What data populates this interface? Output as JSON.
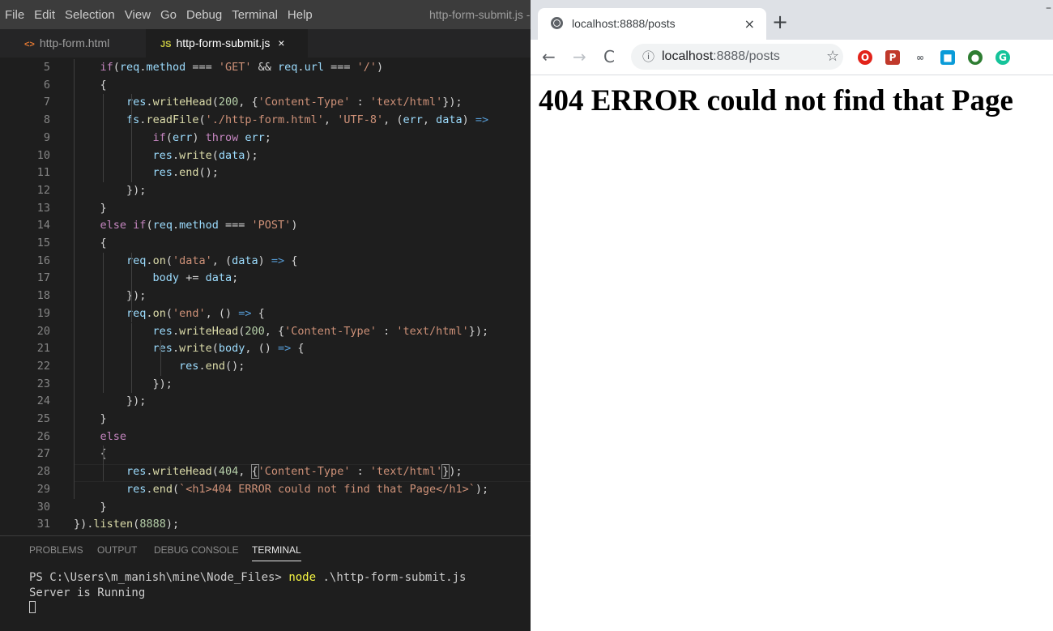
{
  "menu": {
    "items": [
      "File",
      "Edit",
      "Selection",
      "View",
      "Go",
      "Debug",
      "Terminal",
      "Help"
    ],
    "window_title": "http-form-submit.js -"
  },
  "editor_tabs": [
    {
      "icon": "<>",
      "label": "http-form.html",
      "active": false
    },
    {
      "icon": "JS",
      "label": "http-form-submit.js",
      "active": true,
      "close": "×"
    }
  ],
  "code": {
    "line_numbers": [
      "5",
      "6",
      "7",
      "8",
      "9",
      "10",
      "11",
      "12",
      "13",
      "14",
      "15",
      "16",
      "17",
      "18",
      "19",
      "20",
      "21",
      "22",
      "23",
      "24",
      "25",
      "26",
      "27",
      "28",
      "29",
      "30",
      "31"
    ],
    "lines": [
      "    if(req.method === 'GET' && req.url === '/')",
      "    {",
      "        res.writeHead(200, {'Content-Type' : 'text/html'});",
      "        fs.readFile('./http-form.html', 'UTF-8', (err, data) =>",
      "            if(err) throw err;",
      "            res.write(data);",
      "            res.end();",
      "        });",
      "    }",
      "    else if(req.method === 'POST')",
      "    {",
      "        req.on('data', (data) => {",
      "            body += data;",
      "        });",
      "        req.on('end', () => {",
      "            res.writeHead(200, {'Content-Type' : 'text/html'});",
      "            res.write(body, () => {",
      "                res.end();",
      "            });",
      "        });",
      "    }",
      "    else",
      "    {",
      "        res.writeHead(404, {'Content-Type' : 'text/html'});",
      "        res.end(`<h1>404 ERROR could not find that Page</h1>`);",
      "    }",
      "}).listen(8888);"
    ]
  },
  "panel": {
    "tabs": [
      "PROBLEMS",
      "OUTPUT",
      "DEBUG CONSOLE",
      "TERMINAL"
    ],
    "active_tab": "TERMINAL",
    "terminal": {
      "prompt": "PS C:\\Users\\m_manish\\mine\\Node_Files>",
      "command": "node",
      "args": ".\\http-form-submit.js",
      "output": "Server is Running"
    }
  },
  "browser": {
    "tab_title": "localhost:8888/posts",
    "tab_close": "×",
    "new_tab": "+",
    "url_host": "localhost",
    "url_rest": ":8888/posts",
    "page_heading": "404 ERROR could not find that Page",
    "extensions": [
      {
        "name": "opera-icon",
        "color": "#e2231a",
        "glyph": "O"
      },
      {
        "name": "pdf-icon",
        "color": "#c0392b",
        "glyph": "P"
      },
      {
        "name": "link-icon",
        "color": "#5f6368",
        "glyph": "∞"
      },
      {
        "name": "windows-icon",
        "color": "#0a9bd8",
        "glyph": "■"
      },
      {
        "name": "globe-ext-icon",
        "color": "#2e7d32",
        "glyph": "●"
      },
      {
        "name": "grammarly-icon",
        "color": "#15c39a",
        "glyph": "G"
      }
    ]
  }
}
